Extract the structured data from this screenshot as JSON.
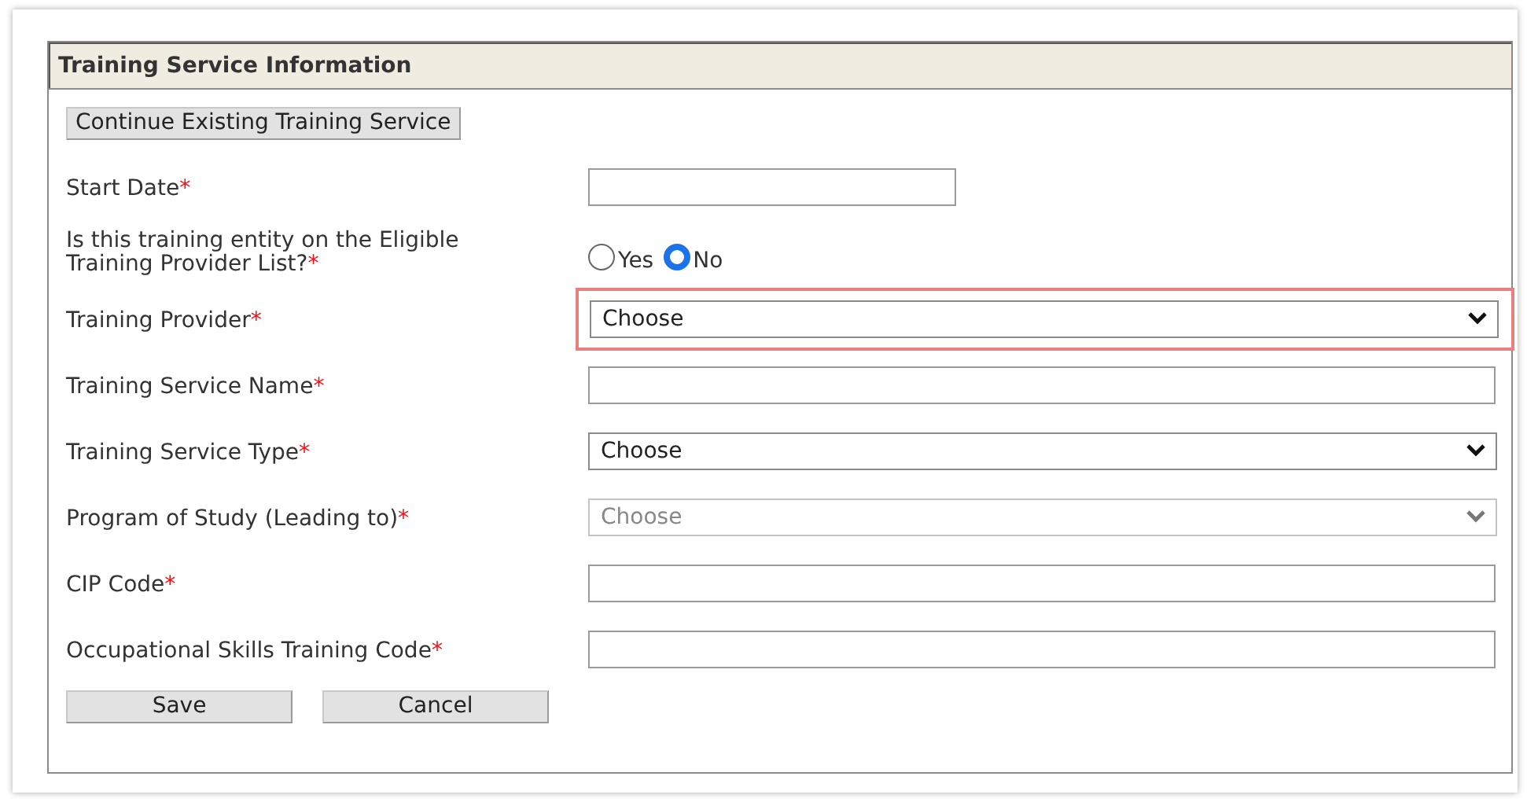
{
  "panel": {
    "title": "Training Service Information"
  },
  "continue_button": "Continue Existing Training Service",
  "fields": [
    {
      "kind": "text",
      "label": "Start Date",
      "required_mark": "*",
      "short": true
    },
    {
      "kind": "radio",
      "label": "Is this training entity on the Eligible Training Provider List?",
      "required_mark": "*",
      "options": [
        {
          "label": "Yes",
          "selected": false
        },
        {
          "label": "No",
          "selected": true
        }
      ]
    },
    {
      "kind": "select",
      "label": "Training Provider",
      "required_mark": "*",
      "value": "Choose",
      "highlighted": true,
      "disabled": false
    },
    {
      "kind": "text",
      "label": "Training Service Name",
      "required_mark": "*",
      "short": false
    },
    {
      "kind": "select",
      "label": "Training Service Type",
      "required_mark": "*",
      "value": "Choose",
      "highlighted": false,
      "disabled": false
    },
    {
      "kind": "select",
      "label": "Program of Study (Leading to)",
      "required_mark": "*",
      "value": "Choose",
      "highlighted": false,
      "disabled": true
    },
    {
      "kind": "text",
      "label": "CIP Code",
      "required_mark": "*",
      "short": false
    },
    {
      "kind": "text",
      "label": "Occupational Skills Training Code",
      "required_mark": "*",
      "short": false
    }
  ],
  "buttons": [
    "Save",
    "Cancel"
  ]
}
